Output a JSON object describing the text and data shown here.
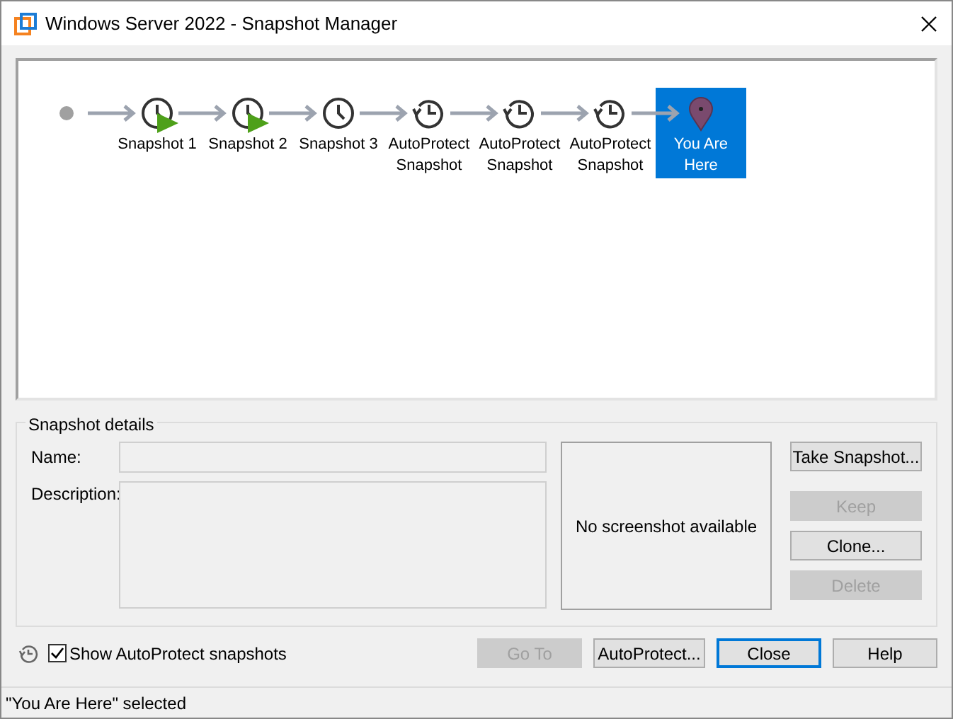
{
  "window": {
    "title": "Windows Server 2022 - Snapshot Manager"
  },
  "tree": {
    "nodes": [
      {
        "kind": "snapshot",
        "label": "Snapshot 1",
        "current": true,
        "selected": false
      },
      {
        "kind": "snapshot",
        "label": "Snapshot 2",
        "current": true,
        "selected": false
      },
      {
        "kind": "snapshot",
        "label": "Snapshot 3",
        "current": false,
        "selected": false
      },
      {
        "kind": "autoprotect",
        "label": "AutoProtect Snapshot",
        "current": false,
        "selected": false
      },
      {
        "kind": "autoprotect",
        "label": "AutoProtect Snapshot",
        "current": false,
        "selected": false
      },
      {
        "kind": "autoprotect",
        "label": "AutoProtect Snapshot",
        "current": false,
        "selected": false
      },
      {
        "kind": "here",
        "label": "You Are Here",
        "current": false,
        "selected": true
      }
    ]
  },
  "details": {
    "title": "Snapshot details",
    "name_label": "Name:",
    "description_label": "Description:",
    "screenshot_text": "No screenshot available",
    "buttons": [
      {
        "label": "Take Snapshot...",
        "disabled": false
      },
      {
        "label": "Keep",
        "disabled": true
      },
      {
        "label": "Clone...",
        "disabled": false
      },
      {
        "label": "Delete",
        "disabled": true
      }
    ]
  },
  "show_autoprotect": {
    "label": "Show AutoProtect snapshots",
    "checked": true
  },
  "buttons": [
    {
      "label": "Go To",
      "disabled": true,
      "default": false
    },
    {
      "label": "AutoProtect...",
      "disabled": false,
      "default": false
    },
    {
      "label": "Close",
      "disabled": false,
      "default": true
    },
    {
      "label": "Help",
      "disabled": false,
      "default": false
    }
  ],
  "status_bar": "\"You Are Here\" selected"
}
